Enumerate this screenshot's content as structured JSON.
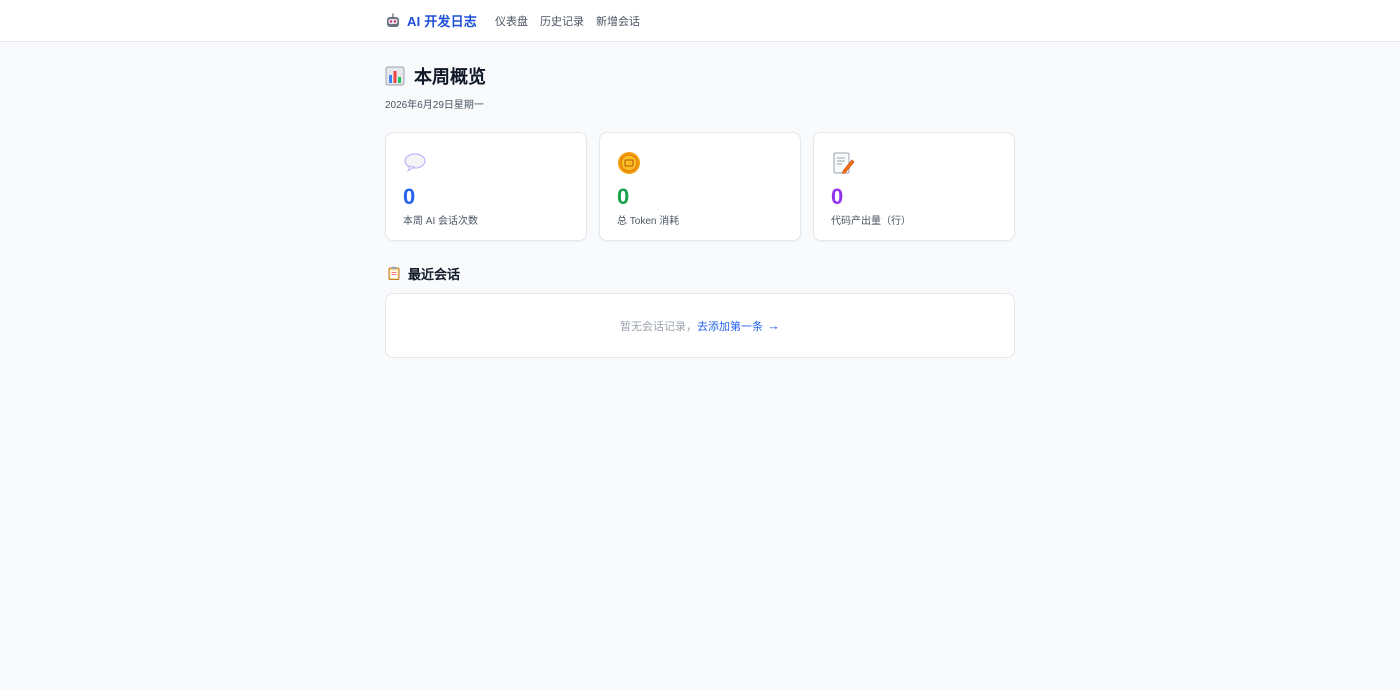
{
  "nav": {
    "brand": "AI 开发日志",
    "brand_icon": "robot-icon",
    "links": [
      "仪表盘",
      "历史记录",
      "新增会话"
    ]
  },
  "header": {
    "title": "本周概览",
    "title_icon": "bar-chart-icon",
    "date": "2026年6月29日星期一"
  },
  "stats": [
    {
      "icon": "speech-bubble-icon",
      "value": "0",
      "label": "本周 AI 会话次数",
      "color": "#2563eb"
    },
    {
      "icon": "coin-icon",
      "value": "0",
      "label": "总 Token 消耗",
      "color": "#16a34a"
    },
    {
      "icon": "memo-icon",
      "value": "0",
      "label": "代码产出量（行）",
      "color": "#9333ea"
    }
  ],
  "recent": {
    "title": "最近会话",
    "title_icon": "clipboard-icon",
    "empty_text": "暂无会话记录，",
    "empty_link": "去添加第一条",
    "empty_arrow": "→"
  },
  "colors": {
    "brand": "#1d4ed8",
    "link": "#2563eb",
    "background": "#f8fafc"
  }
}
